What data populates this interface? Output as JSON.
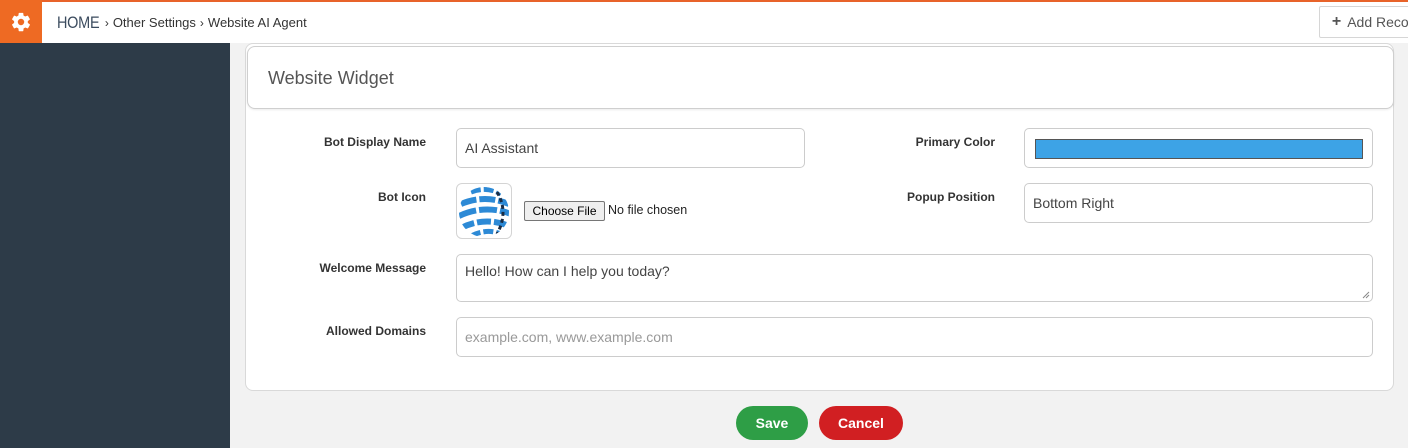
{
  "breadcrumb": {
    "home": "HOME",
    "items": [
      "Other Settings",
      "Website AI Agent"
    ]
  },
  "toolbar": {
    "add_record": "Add Record"
  },
  "panel": {
    "title": "Website Widget"
  },
  "form": {
    "bot_display_name": {
      "label": "Bot Display Name",
      "value": "AI Assistant"
    },
    "primary_color": {
      "label": "Primary Color",
      "value": "#3da3e6"
    },
    "bot_icon": {
      "label": "Bot Icon",
      "button": "Choose File",
      "status": "No file chosen",
      "icon": "globe-logo-icon"
    },
    "popup_position": {
      "label": "Popup Position",
      "value": "Bottom Right"
    },
    "welcome_message": {
      "label": "Welcome Message",
      "value": "Hello! How can I help you today?"
    },
    "allowed_domains": {
      "label": "Allowed Domains",
      "placeholder": "example.com, www.example.com",
      "value": ""
    }
  },
  "actions": {
    "save": "Save",
    "cancel": "Cancel"
  },
  "colors": {
    "accent": "#ee6a23",
    "sidebar": "#2d3b48",
    "save": "#2e9e46",
    "cancel": "#d11f22"
  }
}
